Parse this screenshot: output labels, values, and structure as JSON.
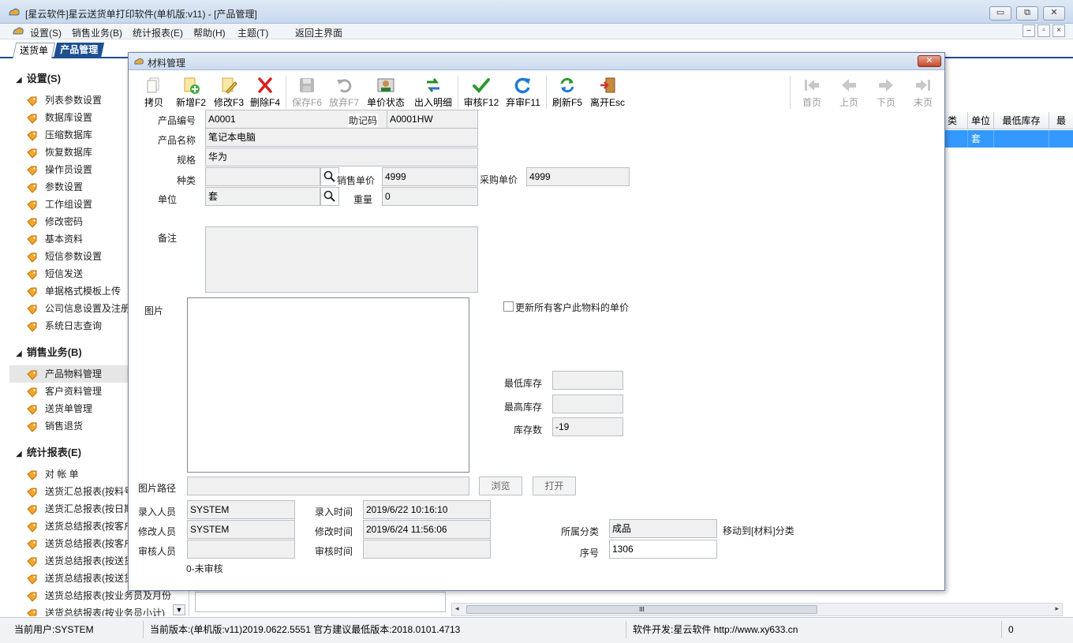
{
  "app": {
    "title": "[星云软件]星云送货单打印软件(单机版:v11) - [产品管理]",
    "window_buttons": {
      "minimize": "▭",
      "maximize": "⧉",
      "close": "✕"
    }
  },
  "menu": {
    "items": [
      "设置(S)",
      "销售业务(B)",
      "统计报表(E)",
      "帮助(H)",
      "主题(T)",
      "返回主界面"
    ],
    "mdi_buttons": [
      "–",
      "▫",
      "×"
    ]
  },
  "tabs": [
    {
      "label": "送货单",
      "active": false
    },
    {
      "label": "产品管理",
      "active": true
    }
  ],
  "sidebar": {
    "sections": [
      {
        "title": "设置(S)",
        "items": [
          "列表参数设置",
          "数据库设置",
          "压缩数据库",
          "恢复数据库",
          "操作员设置",
          "参数设置",
          "工作组设置",
          "修改密码",
          "基本资料",
          "短信参数设置",
          "短信发送",
          "单据格式模板上传",
          "公司信息设置及注册",
          "系统日志查询"
        ]
      },
      {
        "title": "销售业务(B)",
        "items": [
          "产品物料管理",
          "客户资料管理",
          "送货单管理",
          "销售退货"
        ]
      },
      {
        "title": "统计报表(E)",
        "items": [
          "对 帐 单",
          "送货汇总报表(按料号",
          "送货汇总报表(按日期",
          "送货总结报表(按客户",
          "送货总结报表(按客户",
          "送货总结报表(按送货",
          "送货总结报表(按送货",
          "送货总结报表(按业务员及月份",
          "送货总结报表(按业务员小计)"
        ]
      }
    ],
    "selected_item": "产品物料管理"
  },
  "grid": {
    "headers": [
      "类",
      "单位",
      "最低库存",
      "最"
    ],
    "row": [
      "",
      "套",
      "",
      ""
    ],
    "scroll_mark": "III"
  },
  "dialog": {
    "title": "材料管理",
    "close_label": "✕",
    "toolbar": [
      {
        "label": "拷贝",
        "icon": "copy-icon",
        "enabled": true
      },
      {
        "label": "新增F2",
        "icon": "new-icon",
        "enabled": true
      },
      {
        "label": "修改F3",
        "icon": "edit-icon",
        "enabled": true
      },
      {
        "label": "删除F4",
        "icon": "delete-icon",
        "enabled": true
      },
      {
        "label": "保存F6",
        "icon": "save-icon",
        "enabled": false
      },
      {
        "label": "放弃F7",
        "icon": "undo-icon",
        "enabled": false
      },
      {
        "label": "单价状态",
        "icon": "price-status-icon",
        "enabled": true
      },
      {
        "label": "出入明细",
        "icon": "inout-detail-icon",
        "enabled": true
      },
      {
        "label": "审核F12",
        "icon": "approve-icon",
        "enabled": true
      },
      {
        "label": "弃审F11",
        "icon": "unapprove-icon",
        "enabled": true
      },
      {
        "label": "刷新F5",
        "icon": "refresh-icon",
        "enabled": true
      },
      {
        "label": "离开Esc",
        "icon": "exit-icon",
        "enabled": true
      }
    ],
    "nav": [
      {
        "label": "首页",
        "icon": "first-page-icon"
      },
      {
        "label": "上页",
        "icon": "prev-page-icon"
      },
      {
        "label": "下页",
        "icon": "next-page-icon"
      },
      {
        "label": "末页",
        "icon": "last-page-icon"
      }
    ],
    "form": {
      "product_code_label": "产品编号",
      "product_code": "A0001",
      "mnemonic_label": "助记码",
      "mnemonic": "A0001HW",
      "product_name_label": "产品名称",
      "product_name": "笔记本电脑",
      "spec_label": "规格",
      "spec": "华为",
      "category_label": "种类",
      "category": "",
      "sale_price_label": "销售单价",
      "sale_price": "4999",
      "purchase_price_label": "采购单价",
      "purchase_price": "4999",
      "unit_label": "单位",
      "unit": "套",
      "weight_label": "重量",
      "weight": "0",
      "remark_label": "备注",
      "remark": "",
      "picture_label": "图片",
      "update_all_label": "更新所有客户此物料的单价",
      "min_stock_label": "最低库存",
      "min_stock": "",
      "max_stock_label": "最高库存",
      "max_stock": "",
      "stock_qty_label": "库存数",
      "stock_qty": "-19",
      "picture_path_label": "图片路径",
      "picture_path": "",
      "browse_label": "浏览",
      "open_label": "打开",
      "entered_by_label": "录入人员",
      "entered_by": "SYSTEM",
      "entered_time_label": "录入时间",
      "entered_time": "2019/6/22 10:16:10",
      "modified_by_label": "修改人员",
      "modified_by": "SYSTEM",
      "modified_time_label": "修改时间",
      "modified_time": "2019/6/24 11:56:06",
      "reviewer_label": "审核人员",
      "reviewer": "",
      "review_time_label": "审核时间",
      "review_time": "",
      "category_group_label": "所属分类",
      "category_group": "成品",
      "move_to_label": "移动到[材料]分类",
      "seq_label": "序号",
      "seq": "1306",
      "review_status": "0-未审核"
    }
  },
  "status": {
    "user": "当前用户:SYSTEM",
    "version": "当前版本:(单机版:v11)2019.0622.5551 官方建议最低版本:2018.0101.4713",
    "developer": "软件开发:星云软件 http://www.xy633.cn",
    "count": "0"
  },
  "colors": {
    "accent": "#1e4f91",
    "selection": "#3399ff",
    "field_bg": "#f0f0f0"
  }
}
